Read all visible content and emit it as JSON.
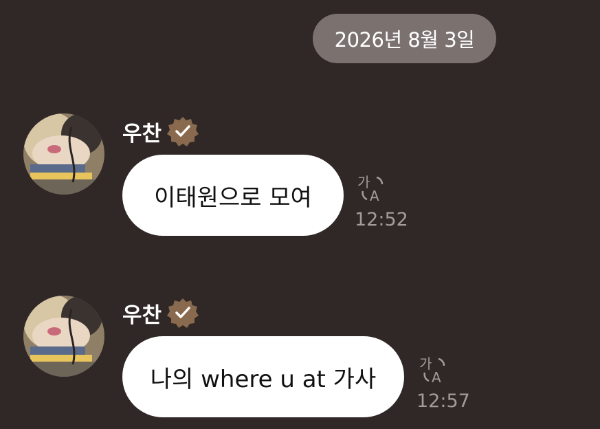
{
  "date_label": "2026년 8월 3일",
  "colors": {
    "background": "#2f2827",
    "date_pill": "#7b7270",
    "bubble": "#ffffff",
    "verified_badge": "#8a6a4e",
    "timestamp": "#a39c9a"
  },
  "messages": [
    {
      "sender": "우찬",
      "verified": true,
      "text": "이태원으로 모여",
      "time": "12:52",
      "icon": "translate-icon"
    },
    {
      "sender": "우찬",
      "verified": true,
      "text": "나의 where u at 가사",
      "time": "12:57",
      "icon": "translate-icon"
    }
  ]
}
